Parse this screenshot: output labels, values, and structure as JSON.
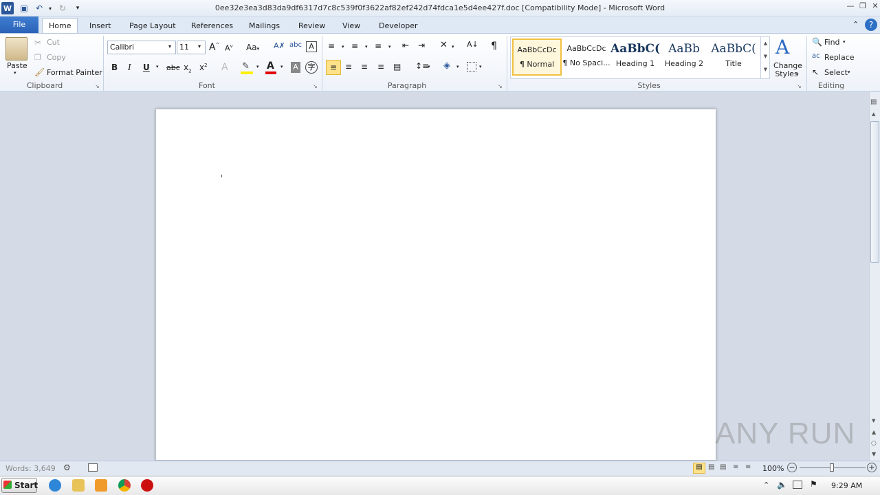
{
  "window": {
    "title": "0ee32e3ea3d83da9df6317d7c8c539f0f3622af82ef242d74fdca1e5d4ee427f.doc [Compatibility Mode]  -  Microsoft Word"
  },
  "tabs": [
    "File",
    "Home",
    "Insert",
    "Page Layout",
    "References",
    "Mailings",
    "Review",
    "View",
    "Developer"
  ],
  "clipboard": {
    "paste": "Paste",
    "cut": "Cut",
    "copy": "Copy",
    "format_painter": "Format Painter",
    "group": "Clipboard"
  },
  "font": {
    "name": "Calibri",
    "size": "11",
    "group": "Font",
    "change_case": "Aa"
  },
  "paragraph": {
    "group": "Paragraph"
  },
  "styles": {
    "group": "Styles",
    "items": [
      {
        "sample": "AaBbCcDc",
        "name": "¶ Normal"
      },
      {
        "sample": "AaBbCcDc",
        "name": "¶ No Spaci..."
      },
      {
        "sample": "AaBbC(",
        "name": "Heading 1"
      },
      {
        "sample": "AaBb",
        "name": "Heading 2"
      },
      {
        "sample": "AaBbC(",
        "name": "Title"
      }
    ],
    "change_styles_1": "Change",
    "change_styles_2": "Styles"
  },
  "editing": {
    "find": "Find",
    "replace": "Replace",
    "select": "Select",
    "group": "Editing"
  },
  "status": {
    "words": "Words: 3,649",
    "zoom": "100%"
  },
  "taskbar": {
    "start": "Start",
    "clock": "9:29 AM"
  },
  "watermark": "ANY RUN",
  "colors": {
    "file_tab": "#2a62b7",
    "ribbon": "#edf2f9",
    "doc_bg": "#d4dbe6",
    "highlight": "#ffef00",
    "font_color": "#e00000"
  }
}
